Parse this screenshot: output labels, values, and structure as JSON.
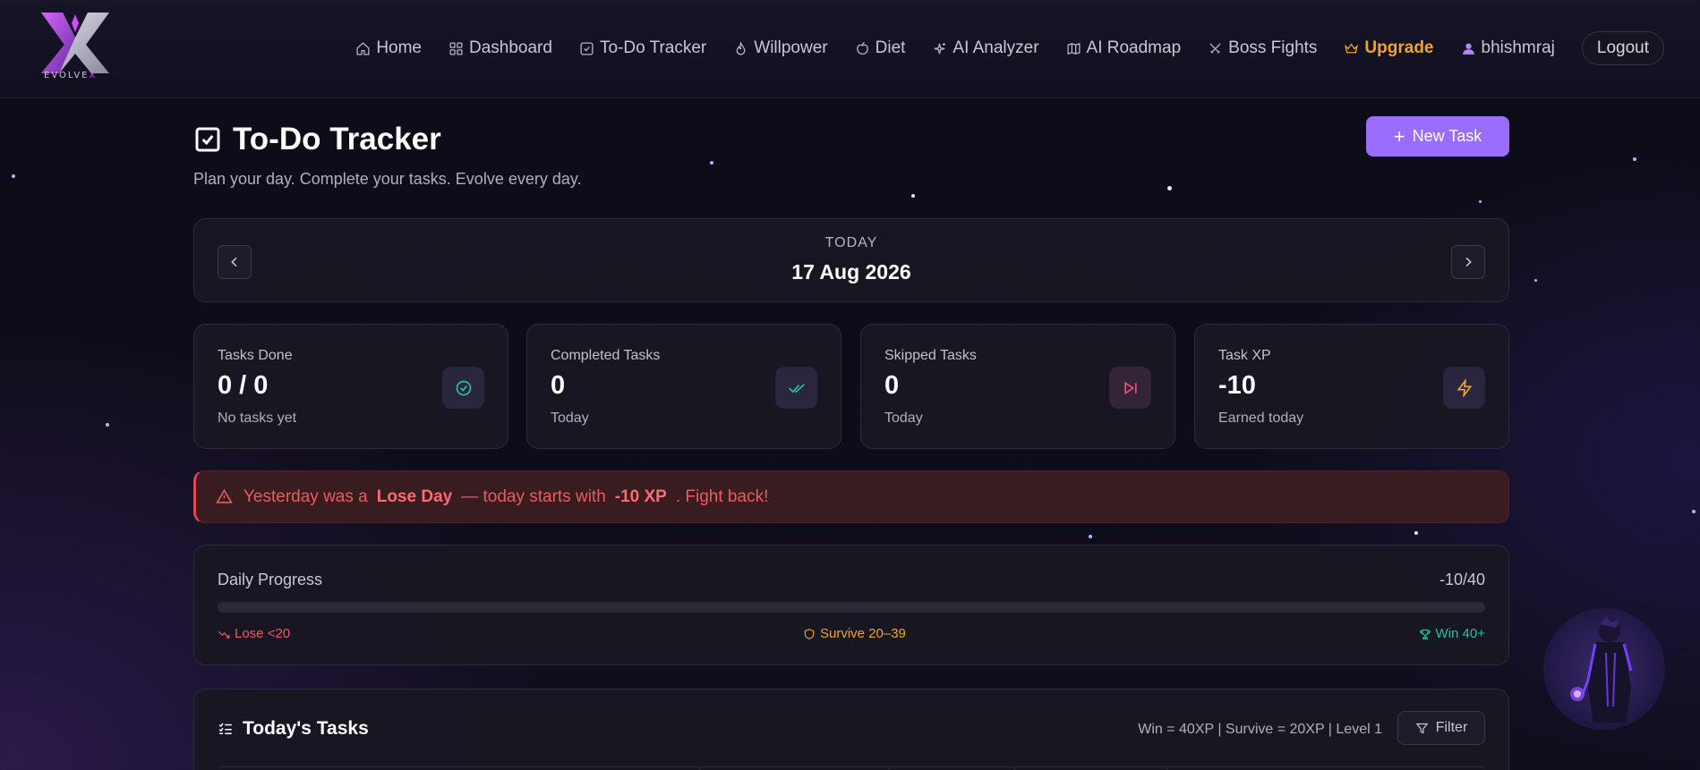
{
  "brand": {
    "logo_text_main": "EVOLVE",
    "logo_text_accent": "X"
  },
  "nav": {
    "items": [
      {
        "label": "Home",
        "icon": "home-icon"
      },
      {
        "label": "Dashboard",
        "icon": "grid-icon"
      },
      {
        "label": "To-Do Tracker",
        "icon": "checkbox-icon"
      },
      {
        "label": "Willpower",
        "icon": "flame-icon"
      },
      {
        "label": "Diet",
        "icon": "apple-icon"
      },
      {
        "label": "AI Analyzer",
        "icon": "sparkles-icon"
      },
      {
        "label": "AI Roadmap",
        "icon": "map-icon"
      },
      {
        "label": "Boss Fights",
        "icon": "swords-icon"
      },
      {
        "label": "Upgrade",
        "icon": "crown-icon"
      },
      {
        "label": "bhishmraj",
        "icon": "user-icon"
      }
    ],
    "logout_label": "Logout"
  },
  "page": {
    "title": "To-Do Tracker",
    "subtitle": "Plan your day. Complete your tasks. Evolve every day.",
    "new_task_label": "New Task"
  },
  "date": {
    "label": "TODAY",
    "value": "17 Aug 2026"
  },
  "stats": [
    {
      "label": "Tasks Done",
      "value": "0 / 0",
      "sub": "No tasks yet",
      "icon": "check-circle-icon",
      "color": "#22c2a0"
    },
    {
      "label": "Completed Tasks",
      "value": "0",
      "sub": "Today",
      "icon": "double-check-icon",
      "color": "#22c2a0"
    },
    {
      "label": "Skipped Tasks",
      "value": "0",
      "sub": "Today",
      "icon": "skip-forward-icon",
      "color": "#ef4d7a"
    },
    {
      "label": "Task XP",
      "value": "-10",
      "sub": "Earned today",
      "icon": "lightning-icon",
      "color": "#f0a52a"
    }
  ],
  "alert": {
    "prefix": "Yesterday was a",
    "strong1": "Lose Day",
    "middle": "— today starts with",
    "strong2": "-10 XP",
    "suffix": ". Fight back!"
  },
  "progress": {
    "label": "Daily Progress",
    "value_text": "-10/40",
    "fraction": 0,
    "lose_label": "Lose <20",
    "survive_label": "Survive 20–39",
    "win_label": "Win 40+",
    "lose_color": "#ee5a5e",
    "survive_color": "#f0a52a",
    "win_color": "#22c2a0"
  },
  "tasks": {
    "title": "Today's Tasks",
    "meta": "Win = 40XP | Survive = 20XP | Level 1",
    "filter_label": "Filter"
  }
}
